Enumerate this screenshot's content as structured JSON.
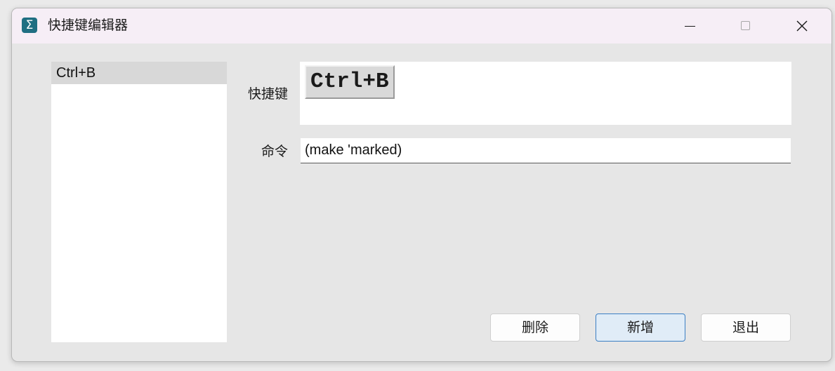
{
  "window": {
    "title": "快捷键编辑器",
    "app_icon_glyph": "Σ",
    "icon": "sigma-app-icon"
  },
  "list": {
    "items": [
      {
        "label": "Ctrl+B",
        "selected": true
      }
    ]
  },
  "form": {
    "shortcut_label": "快捷键",
    "shortcut_value": "Ctrl+B",
    "command_label": "命令",
    "command_value": "(make 'marked)"
  },
  "buttons": {
    "delete": "删除",
    "add": "新增",
    "exit": "退出"
  },
  "colors": {
    "titlebar": "#f6eef6",
    "window_bg": "#e6e6e6",
    "selected_item": "#d8d8d8",
    "focused_button_border": "#3b7fc4",
    "focused_button_bg": "#e0ecf7"
  }
}
